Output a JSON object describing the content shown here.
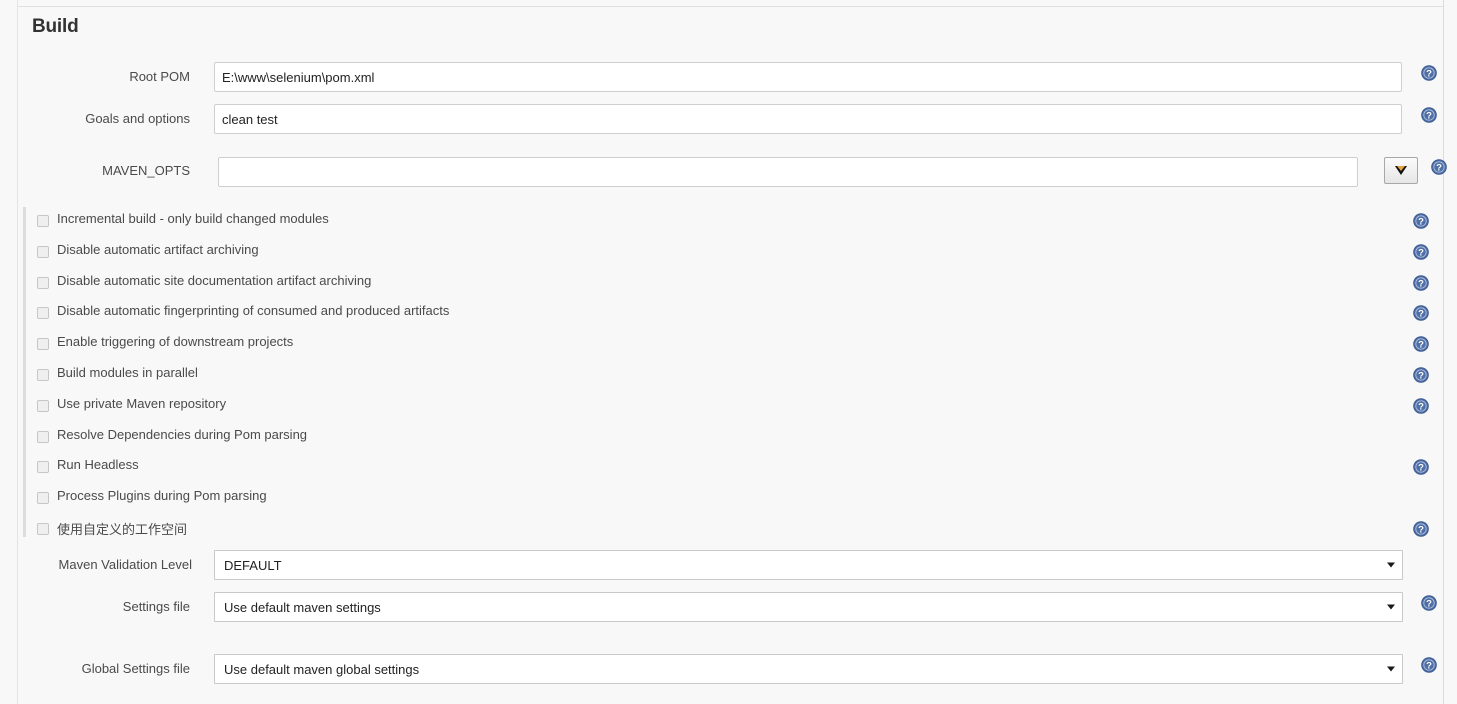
{
  "section": {
    "title": "Build"
  },
  "fields": {
    "root_pom": {
      "label": "Root POM",
      "value": "E:\\www\\selenium\\pom.xml",
      "placeholder": ""
    },
    "goals": {
      "label": "Goals and options",
      "value": "clean test",
      "placeholder": ""
    },
    "maven_opts": {
      "label": "MAVEN_OPTS",
      "value": "",
      "placeholder": "",
      "dropdown_icon": "triangle-down-icon"
    }
  },
  "checkboxes": [
    {
      "label": "Incremental build - only build changed modules",
      "checked": false,
      "help": true
    },
    {
      "label": "Disable automatic artifact archiving",
      "checked": false,
      "help": true
    },
    {
      "label": "Disable automatic site documentation artifact archiving",
      "checked": false,
      "help": true
    },
    {
      "label": "Disable automatic fingerprinting of consumed and produced artifacts",
      "checked": false,
      "help": true
    },
    {
      "label": "Enable triggering of downstream projects",
      "checked": false,
      "help": true
    },
    {
      "label": "Build modules in parallel",
      "checked": false,
      "help": true
    },
    {
      "label": "Use private Maven repository",
      "checked": false,
      "help": true
    },
    {
      "label": "Resolve Dependencies during Pom parsing",
      "checked": false,
      "help": false
    },
    {
      "label": "Run Headless",
      "checked": false,
      "help": true
    },
    {
      "label": "Process Plugins during Pom parsing",
      "checked": false,
      "help": false
    },
    {
      "label": "使用自定义的工作空间",
      "checked": false,
      "help": true
    }
  ],
  "selects": {
    "validation_level": {
      "label": "Maven Validation Level",
      "value": "DEFAULT"
    },
    "settings_file": {
      "label": "Settings file",
      "value": "Use default maven settings"
    },
    "global_settings_file": {
      "label": "Global Settings file",
      "value": "Use default maven global settings"
    }
  },
  "icons": {
    "help": "help-icon",
    "help_glyph": "?"
  },
  "colors": {
    "page_bg": "#f8f8f8",
    "input_bg": "#ffffff",
    "input_border": "#cfcfcf",
    "label_text": "#4a4a4a",
    "title_text": "#333333",
    "help_blue": "#4f6fa8",
    "rule": "#e0e0e0"
  }
}
